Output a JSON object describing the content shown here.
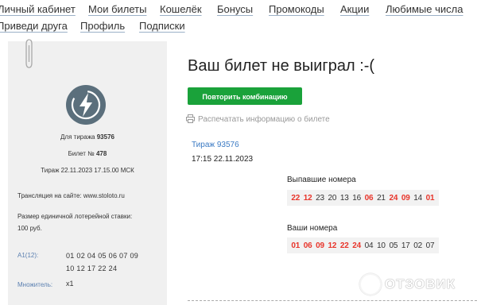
{
  "nav": {
    "row1": [
      "Личный кабинет",
      "Мои билеты",
      "Кошелёк",
      "Бонусы",
      "Промокоды",
      "Акции",
      "Любимые числа"
    ],
    "row2": [
      "Приведи друга",
      "Профиль",
      "Подписки"
    ]
  },
  "ticket": {
    "draw_prefix": "Для тиража",
    "draw_number": "93576",
    "ticket_prefix": "Билет №",
    "ticket_number": "478",
    "draw_datetime": "Тираж 22.11.2023 17.15.00 МСК",
    "broadcast": "Трансляция на сайте: www.stoloto.ru",
    "bet_size_line1": "Размер единичной лотерейной ставки:",
    "bet_size_line2": "100 руб.",
    "combo_label": "А1(12):",
    "combo_line1": "01 02 04 05 06 07 09",
    "combo_line2": "10 12 17 22 24",
    "multiplier_label": "Множитель:",
    "multiplier_value": "x1"
  },
  "result": {
    "title": "Ваш билет не выиграл :-(",
    "repeat_button": "Повторить комбинацию",
    "print_link": "Распечатать информацию о билете",
    "draw_link": "Тираж 93576",
    "draw_time": "17:15 22.11.2023",
    "drawn_label": "Выпавшие номера",
    "drawn_numbers": [
      {
        "n": "22",
        "hit": true
      },
      {
        "n": "12",
        "hit": true
      },
      {
        "n": "23",
        "hit": false
      },
      {
        "n": "20",
        "hit": false
      },
      {
        "n": "13",
        "hit": false
      },
      {
        "n": "16",
        "hit": false
      },
      {
        "n": "06",
        "hit": true
      },
      {
        "n": "21",
        "hit": false
      },
      {
        "n": "24",
        "hit": true
      },
      {
        "n": "09",
        "hit": true
      },
      {
        "n": "14",
        "hit": false
      },
      {
        "n": "01",
        "hit": true
      }
    ],
    "your_label": "Ваши номера",
    "your_numbers": [
      {
        "n": "01",
        "hit": true
      },
      {
        "n": "06",
        "hit": true
      },
      {
        "n": "09",
        "hit": true
      },
      {
        "n": "12",
        "hit": true
      },
      {
        "n": "22",
        "hit": true
      },
      {
        "n": "24",
        "hit": true
      },
      {
        "n": "04",
        "hit": false
      },
      {
        "n": "10",
        "hit": false
      },
      {
        "n": "05",
        "hit": false
      },
      {
        "n": "17",
        "hit": false
      },
      {
        "n": "02",
        "hit": false
      },
      {
        "n": "07",
        "hit": false
      }
    ]
  },
  "watermark": "ОТЗОВИК",
  "colors": {
    "accent_green": "#1aa23a",
    "hit_red": "#e8352b",
    "link_blue": "#3c7bc4"
  }
}
